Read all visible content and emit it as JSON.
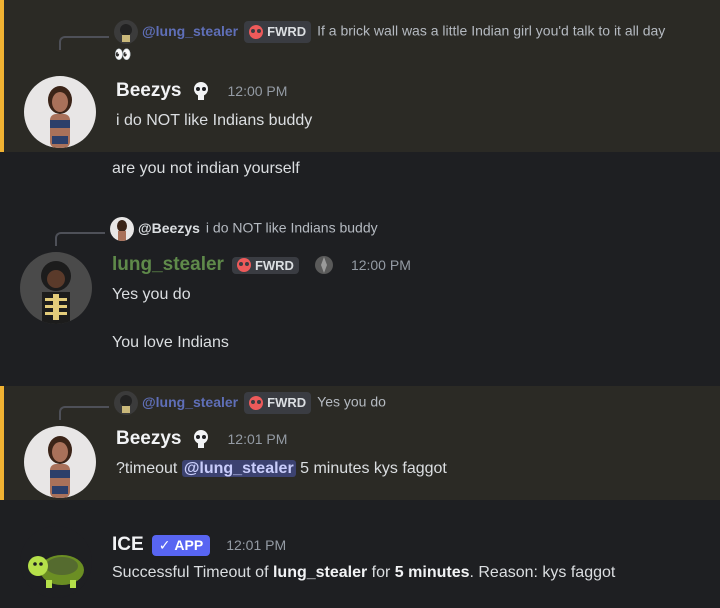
{
  "messages": [
    {
      "reply": {
        "user": "@lung_stealer",
        "badge": "FWRD",
        "text": "If a brick wall was a little Indian girl you'd talk to it all day👀"
      },
      "author": "Beezys",
      "time": "12:00 PM",
      "lines": [
        "i do NOT like Indians buddy"
      ]
    },
    {
      "continuation": "are you not indian yourself"
    },
    {
      "reply": {
        "user": "@Beezys",
        "text": "i do NOT like Indians buddy"
      },
      "author": "lung_stealer",
      "badge": "FWRD",
      "time": "12:00 PM",
      "lines": [
        "Yes you do",
        "You love Indians"
      ]
    },
    {
      "reply": {
        "user": "@lung_stealer",
        "badge": "FWRD",
        "text": "Yes you do"
      },
      "author": "Beezys",
      "time": "12:01 PM",
      "cmd_prefix": "?timeout ",
      "mention": "@lung_stealer",
      "cmd_suffix": " 5 minutes kys faggot"
    },
    {
      "author": "ICE",
      "app_badge": "APP",
      "time": "12:01 PM",
      "t1": "Successful Timeout of ",
      "target": "lung_stealer",
      "t2": " for ",
      "duration": "5 minutes",
      "t3": ". Reason: kys faggot"
    }
  ],
  "colors": {
    "background": "#1e1f22",
    "highlight": "#2b2a25",
    "highlight_border": "#f0b232",
    "app_badge": "#5865f2"
  }
}
